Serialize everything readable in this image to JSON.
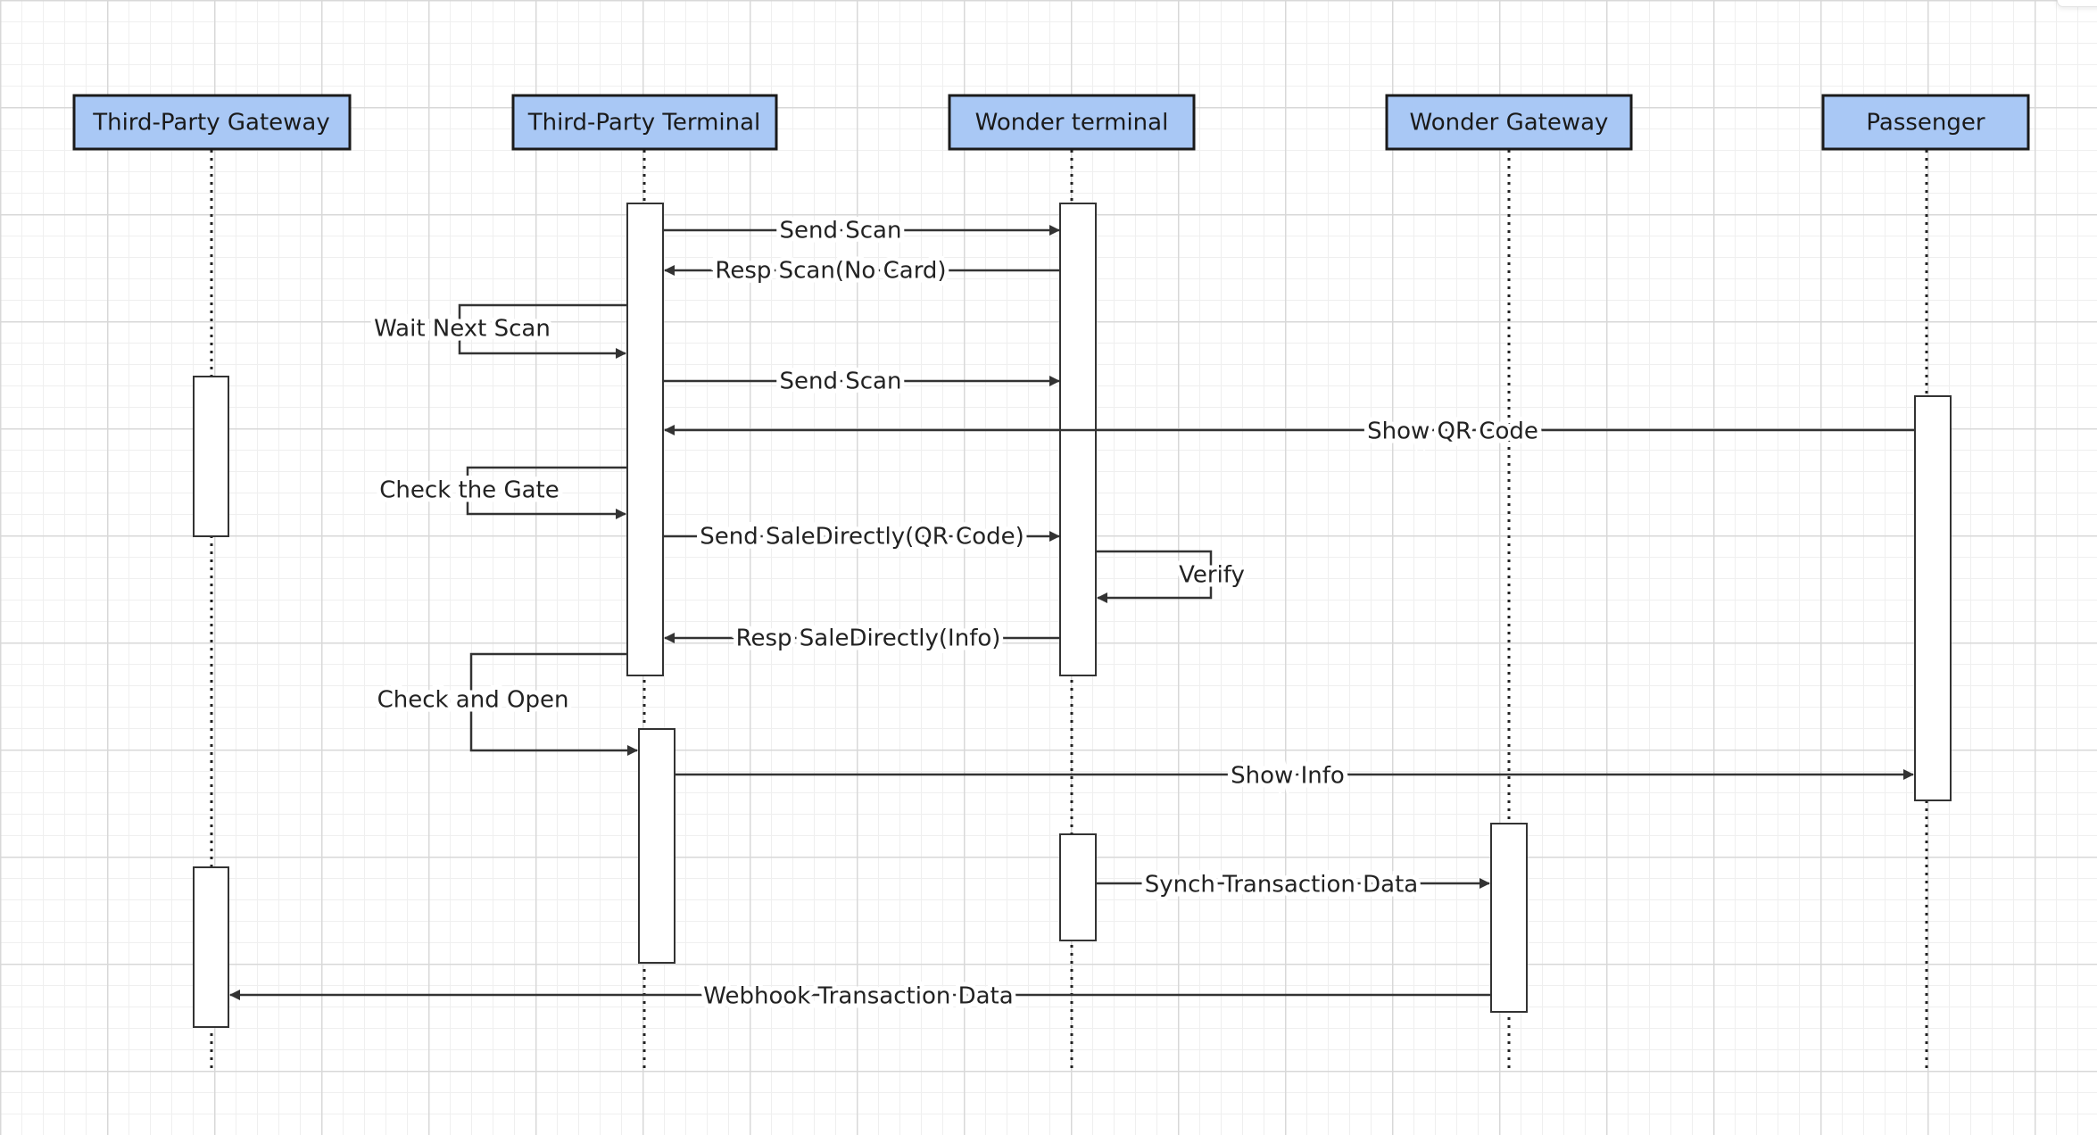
{
  "diagram": {
    "participants": [
      {
        "id": "tpg",
        "label": "Third-Party Gateway"
      },
      {
        "id": "tpt",
        "label": "Third-Party Terminal"
      },
      {
        "id": "wt",
        "label": "Wonder terminal"
      },
      {
        "id": "wg",
        "label": "Wonder Gateway"
      },
      {
        "id": "p",
        "label": "Passenger"
      }
    ],
    "messages": [
      {
        "id": "send-scan-1",
        "label": "Send Scan"
      },
      {
        "id": "resp-scan",
        "label": "Resp Scan(No Card)"
      },
      {
        "id": "wait-next-scan",
        "label": "Wait Next Scan"
      },
      {
        "id": "send-scan-2",
        "label": "Send Scan"
      },
      {
        "id": "show-qr",
        "label": "Show QR Code"
      },
      {
        "id": "check-gate",
        "label": "Check the Gate"
      },
      {
        "id": "send-sale",
        "label": "Send SaleDirectly(QR Code)"
      },
      {
        "id": "verify",
        "label": "Verify"
      },
      {
        "id": "resp-sale",
        "label": "Resp SaleDirectly(Info)"
      },
      {
        "id": "check-open",
        "label": "Check and Open"
      },
      {
        "id": "show-info",
        "label": "Show Info"
      },
      {
        "id": "synch",
        "label": "Synch Transaction Data"
      },
      {
        "id": "webhook",
        "label": "Webhook Transaction Data"
      }
    ],
    "colors": {
      "participant_fill": "#a9c8f5",
      "line": "#333333",
      "activation_fill": "#ffffff"
    }
  }
}
